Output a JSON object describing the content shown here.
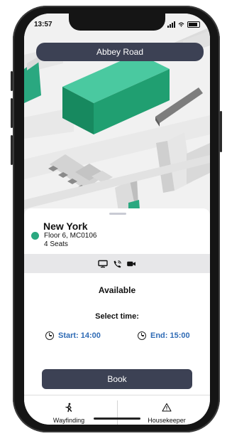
{
  "status": {
    "time": "13:57",
    "icons": [
      "cellular-signal-icon",
      "wifi-icon",
      "battery-icon"
    ]
  },
  "header": {
    "location_name": "Abbey Road"
  },
  "room": {
    "name": "New York",
    "floor_and_id": "Floor 6, MC0106",
    "seats": "4 Seats",
    "status_color": "#2aa880",
    "amenities": [
      "monitor-icon",
      "phone-icon",
      "video-camera-icon"
    ]
  },
  "availability": {
    "status": "Available",
    "select_time_label": "Select time:",
    "start_label": "Start: 14:00",
    "end_label": "End: 15:00",
    "book_label": "Book"
  },
  "tabs": [
    {
      "label": "Wayfinding",
      "icon": "walking-person-icon"
    },
    {
      "label": "Housekeeper",
      "icon": "warning-triangle-icon"
    }
  ],
  "colors": {
    "accent_dark": "#3c4154",
    "link_blue": "#2f6bb5",
    "green": "#2aa880"
  }
}
